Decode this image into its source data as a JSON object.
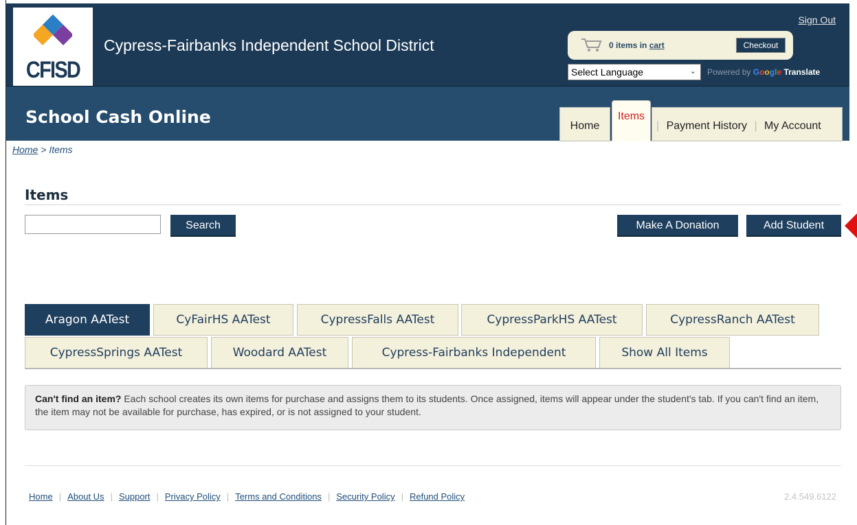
{
  "header": {
    "logo_text": "CFISD",
    "district_name": "Cypress-Fairbanks Independent School District",
    "sign_out": "Sign Out",
    "cart": {
      "count_text": "0 items in",
      "cart_link": "cart",
      "checkout": "Checkout"
    },
    "language": {
      "selected": "Select Language",
      "powered_by": "Powered by",
      "google": [
        "G",
        "o",
        "o",
        "g",
        "l",
        "e"
      ],
      "translate": "Translate"
    },
    "app_title": "School Cash Online"
  },
  "nav": {
    "home": "Home",
    "items": "Items",
    "payment_history": "Payment History",
    "my_account": "My Account",
    "active": "Items"
  },
  "breadcrumb": {
    "home": "Home",
    "separator": ">",
    "current": "Items"
  },
  "page": {
    "title": "Items",
    "search_value": "",
    "search_button": "Search",
    "donate_button": "Make A Donation",
    "add_student_button": "Add Student"
  },
  "tabs": [
    {
      "label": "Aragon AATest",
      "active": true
    },
    {
      "label": "CyFairHS AATest",
      "active": false
    },
    {
      "label": "CypressFalls AATest",
      "active": false
    },
    {
      "label": "CypressParkHS AATest",
      "active": false
    },
    {
      "label": "CypressRanch AATest",
      "active": false
    },
    {
      "label": "CypressSprings AATest",
      "active": false
    },
    {
      "label": "Woodard AATest",
      "active": false
    },
    {
      "label": "Cypress-Fairbanks Independent",
      "active": false
    },
    {
      "label": "Show All Items",
      "active": false
    }
  ],
  "info": {
    "heading": "Can't find an item?",
    "body": "Each school creates its own items for purchase and assigns them to its students. Once assigned, items will appear under the student's tab. If you can't find an item, the item may not be available for purchase, has expired, or is not assigned to your student."
  },
  "footer": {
    "links": [
      "Home",
      "About Us",
      "Support",
      "Privacy Policy",
      "Terms and Conditions",
      "Security Policy",
      "Refund Policy"
    ],
    "version": "2.4.549.6122"
  },
  "colors": {
    "header_dark": "#1c3a55",
    "header_band": "#264d6e",
    "button": "#1e3f5e",
    "tab_bg": "#f3f0dc",
    "active_nav_text": "#d02020",
    "pointer": "#e01010"
  },
  "icons": [
    "cfisd-logo-mark",
    "shopping-cart-icon",
    "dropdown-caret-icon",
    "red-pointer-arrow"
  ]
}
